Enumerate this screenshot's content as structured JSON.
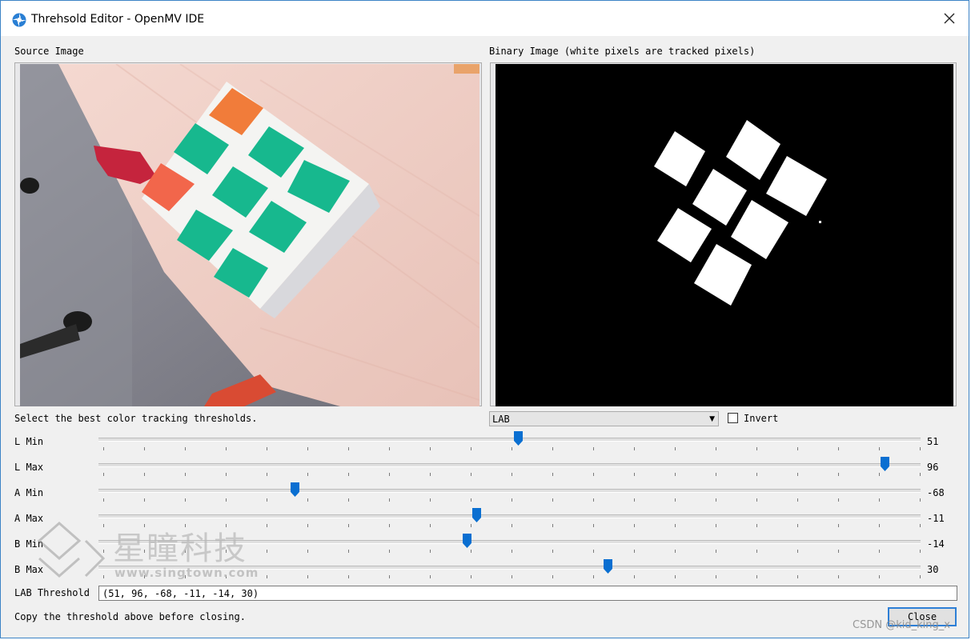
{
  "window": {
    "title": "Threhsold Editor - OpenMV IDE"
  },
  "source": {
    "label": "Source Image"
  },
  "binary": {
    "label": "Binary Image (white pixels are tracked pixels)"
  },
  "instructions": "Select the best color tracking thresholds.",
  "color_space": {
    "selected": "LAB"
  },
  "invert": {
    "label": "Invert",
    "checked": false
  },
  "sliders": [
    {
      "label": "L Min",
      "value": "51",
      "min": 0,
      "max": 100
    },
    {
      "label": "L Max",
      "value": "96",
      "min": 0,
      "max": 100
    },
    {
      "label": "A Min",
      "value": "-68",
      "min": -128,
      "max": 127
    },
    {
      "label": "A Max",
      "value": "-11",
      "min": -128,
      "max": 127
    },
    {
      "label": "B Min",
      "value": "-14",
      "min": -128,
      "max": 127
    },
    {
      "label": "B Max",
      "value": "30",
      "min": -128,
      "max": 127
    }
  ],
  "threshold": {
    "label": "LAB Threshold",
    "value": "(51, 96, -68, -11, -14, 30)"
  },
  "footer": {
    "note": "Copy the threshold above before closing.",
    "close_label": "Close"
  },
  "watermarks": {
    "csdn": "CSDN @kid_king_x",
    "brand_cn": "星瞳科技",
    "brand_url": "www.singtown.com"
  },
  "colors": {
    "accent": "#0a6fd1",
    "window_bg": "#f0f0f0",
    "cube_green": "#16b88c",
    "cube_orange": "#f26d3d"
  }
}
